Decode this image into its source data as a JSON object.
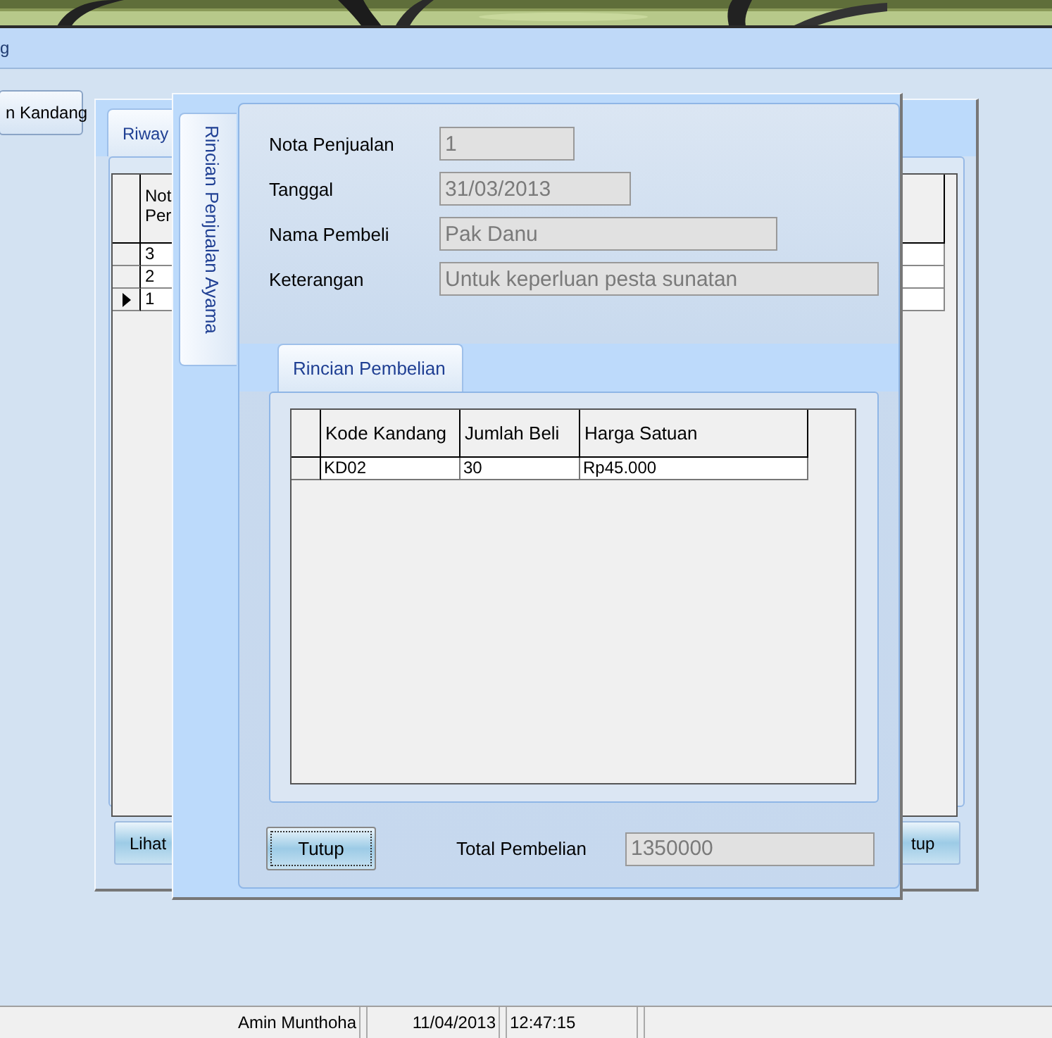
{
  "menu_bar": {
    "items": [
      "g"
    ]
  },
  "toolbar": {
    "buttons": [
      "n Kandang"
    ]
  },
  "back_window": {
    "tabs": [
      {
        "label": "Riway",
        "selected": true
      }
    ],
    "grid": {
      "columns": [
        "Not\nPer"
      ],
      "rows": [
        {
          "cells": [
            "3"
          ],
          "current": false
        },
        {
          "cells": [
            "2"
          ],
          "current": false
        },
        {
          "cells": [
            "1"
          ],
          "current": true
        }
      ]
    },
    "buttons": [
      "Lihat",
      "tup"
    ]
  },
  "dialog": {
    "side_tabs": [
      {
        "label": "Rincian Penjualan Ayama",
        "selected": true
      }
    ],
    "fields": [
      {
        "label": "Nota Penjualan",
        "value": "1",
        "disabled": true
      },
      {
        "label": "Tanggal",
        "value": "31/03/2013",
        "disabled": true
      },
      {
        "label": "Nama Pembeli",
        "value": "Pak Danu",
        "disabled": true
      },
      {
        "label": "Keterangan",
        "value": "Untuk keperluan pesta sunatan",
        "disabled": true
      }
    ],
    "inner_tabs": [
      {
        "label": "Rincian Pembelian",
        "selected": true
      }
    ],
    "grid": {
      "columns": [
        "Kode Kandang",
        "Jumlah Beli",
        "Harga Satuan"
      ],
      "rows": [
        {
          "cells": [
            "KD02",
            "30",
            "Rp45.000"
          ],
          "current": false
        }
      ]
    },
    "close_button": "Tutup",
    "total": {
      "label": "Total Pembelian",
      "value": "1350000",
      "disabled": true
    }
  },
  "status_bar": {
    "cells": [
      "Amin Munthoha",
      "11/04/2013",
      "12:47:15"
    ]
  }
}
